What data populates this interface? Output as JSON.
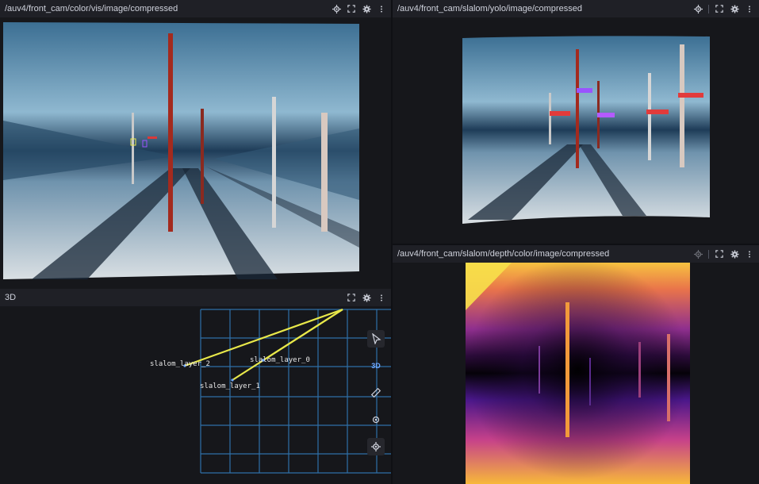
{
  "panels": {
    "color_vis": {
      "topic": "/auv4/front_cam/color/vis/image/compressed"
    },
    "yolo": {
      "topic": "/auv4/front_cam/slalom/yolo/image/compressed"
    },
    "depth": {
      "topic": "/auv4/front_cam/slalom/depth/color/image/compressed"
    },
    "three_d": {
      "title": "3D",
      "frames": [
        "slalom_layer_2",
        "slalom_layer_0",
        "slalom_layer_1"
      ],
      "toolbar": {
        "mode_label": "3D"
      }
    }
  },
  "icons": [
    "crosshair-icon",
    "fullscreen-icon",
    "gear-icon",
    "more-vertical-icon",
    "pointer-icon",
    "ruler-icon",
    "publish-point-icon",
    "follow-icon"
  ],
  "colors": {
    "accent": "#6b5fb0",
    "grid": "#2f6fa8",
    "frame_line": "#e8e84a",
    "mode": "#6fa8ff"
  }
}
